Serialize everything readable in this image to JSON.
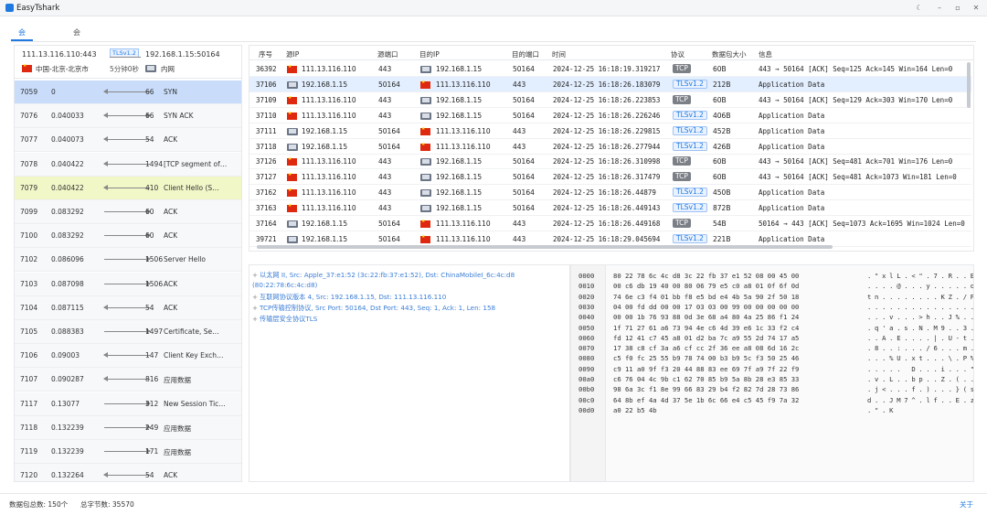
{
  "window": {
    "title": "EasyTshark"
  },
  "tabs": [
    {
      "label": "会话时序图",
      "active": true
    },
    {
      "label": "会话数据流",
      "active": false
    }
  ],
  "session_header": {
    "src": "111.13.116.110:443",
    "dst": "192.168.1.15:50164",
    "protocol": "TLSv1.2",
    "duration": "5分钟0秒",
    "src_location": "中国-北京-北京市",
    "dst_location": "内网"
  },
  "session_rows": [
    {
      "no": "7059",
      "time": "0",
      "len": "66",
      "info": "SYN",
      "dir": "left",
      "state": "selected"
    },
    {
      "no": "7076",
      "time": "0.040033",
      "len": "66",
      "info": "SYN ACK",
      "dir": "left-right",
      "state": ""
    },
    {
      "no": "7077",
      "time": "0.040073",
      "len": "54",
      "info": "ACK",
      "dir": "left",
      "state": ""
    },
    {
      "no": "7078",
      "time": "0.040422",
      "len": "1494",
      "info": "[TCP segment of…",
      "dir": "left",
      "state": ""
    },
    {
      "no": "7079",
      "time": "0.040422",
      "len": "410",
      "info": "Client Hello (S…",
      "dir": "left",
      "state": "highlight"
    },
    {
      "no": "7099",
      "time": "0.083292",
      "len": "60",
      "info": "ACK",
      "dir": "right",
      "state": ""
    },
    {
      "no": "7100",
      "time": "0.083292",
      "len": "60",
      "info": "ACK",
      "dir": "right",
      "state": ""
    },
    {
      "no": "7102",
      "time": "0.086096",
      "len": "1506",
      "info": "Server Hello",
      "dir": "right",
      "state": ""
    },
    {
      "no": "7103",
      "time": "0.087098",
      "len": "1506",
      "info": "ACK",
      "dir": "right",
      "state": ""
    },
    {
      "no": "7104",
      "time": "0.087115",
      "len": "54",
      "info": "ACK",
      "dir": "left",
      "state": ""
    },
    {
      "no": "7105",
      "time": "0.088383",
      "len": "1497",
      "info": "Certificate, Se…",
      "dir": "right",
      "state": ""
    },
    {
      "no": "7106",
      "time": "0.09003",
      "len": "147",
      "info": "Client Key Exch…",
      "dir": "left",
      "state": ""
    },
    {
      "no": "7107",
      "time": "0.090287",
      "len": "816",
      "info": "应用数据",
      "dir": "left",
      "state": ""
    },
    {
      "no": "7117",
      "time": "0.13077",
      "len": "312",
      "info": "New Session Tic…",
      "dir": "right",
      "state": ""
    },
    {
      "no": "7118",
      "time": "0.132239",
      "len": "249",
      "info": "应用数据",
      "dir": "right",
      "state": ""
    },
    {
      "no": "7119",
      "time": "0.132239",
      "len": "171",
      "info": "应用数据",
      "dir": "right",
      "state": ""
    },
    {
      "no": "7120",
      "time": "0.132264",
      "len": "54",
      "info": "ACK",
      "dir": "left",
      "state": ""
    }
  ],
  "packet_table": {
    "columns": [
      "序号",
      "源IP",
      "源端口",
      "目的IP",
      "目的端口",
      "时间",
      "协议",
      "数据包大小",
      "信息"
    ],
    "rows": [
      {
        "no": "36392",
        "src_ip": "111.13.116.110",
        "src_cn": true,
        "src_port": "443",
        "dst_ip": "192.168.1.15",
        "dst_cn": false,
        "dst_port": "50164",
        "time": "2024-12-25 16:18:19.319217",
        "proto": "TCP",
        "size": "60B",
        "info": "443 → 50164 [ACK] Seq=125 Ack=145 Win=164 Len=0"
      },
      {
        "no": "37106",
        "src_ip": "192.168.1.15",
        "src_cn": false,
        "src_port": "50164",
        "dst_ip": "111.13.116.110",
        "dst_cn": true,
        "dst_port": "443",
        "time": "2024-12-25 16:18:26.183079",
        "proto": "TLSv1.2",
        "size": "212B",
        "info": "Application Data"
      },
      {
        "no": "37109",
        "src_ip": "111.13.116.110",
        "src_cn": true,
        "src_port": "443",
        "dst_ip": "192.168.1.15",
        "dst_cn": false,
        "dst_port": "50164",
        "time": "2024-12-25 16:18:26.223853",
        "proto": "TCP",
        "size": "60B",
        "info": "443 → 50164 [ACK] Seq=129 Ack=303 Win=170 Len=0"
      },
      {
        "no": "37110",
        "src_ip": "111.13.116.110",
        "src_cn": true,
        "src_port": "443",
        "dst_ip": "192.168.1.15",
        "dst_cn": false,
        "dst_port": "50164",
        "time": "2024-12-25 16:18:26.226246",
        "proto": "TLSv1.2",
        "size": "406B",
        "info": "Application Data"
      },
      {
        "no": "37111",
        "src_ip": "192.168.1.15",
        "src_cn": false,
        "src_port": "50164",
        "dst_ip": "111.13.116.110",
        "dst_cn": true,
        "dst_port": "443",
        "time": "2024-12-25 16:18:26.229815",
        "proto": "TLSv1.2",
        "size": "452B",
        "info": "Application Data"
      },
      {
        "no": "37118",
        "src_ip": "192.168.1.15",
        "src_cn": false,
        "src_port": "50164",
        "dst_ip": "111.13.116.110",
        "dst_cn": true,
        "dst_port": "443",
        "time": "2024-12-25 16:18:26.277944",
        "proto": "TLSv1.2",
        "size": "426B",
        "info": "Application Data"
      },
      {
        "no": "37126",
        "src_ip": "111.13.116.110",
        "src_cn": true,
        "src_port": "443",
        "dst_ip": "192.168.1.15",
        "dst_cn": false,
        "dst_port": "50164",
        "time": "2024-12-25 16:18:26.310998",
        "proto": "TCP",
        "size": "60B",
        "info": "443 → 50164 [ACK] Seq=481 Ack=701 Win=176 Len=0"
      },
      {
        "no": "37127",
        "src_ip": "111.13.116.110",
        "src_cn": true,
        "src_port": "443",
        "dst_ip": "192.168.1.15",
        "dst_cn": false,
        "dst_port": "50164",
        "time": "2024-12-25 16:18:26.317479",
        "proto": "TCP",
        "size": "60B",
        "info": "443 → 50164 [ACK] Seq=481 Ack=1073 Win=181 Len=0"
      },
      {
        "no": "37162",
        "src_ip": "111.13.116.110",
        "src_cn": true,
        "src_port": "443",
        "dst_ip": "192.168.1.15",
        "dst_cn": false,
        "dst_port": "50164",
        "time": "2024-12-25 16:18:26.44879",
        "proto": "TLSv1.2",
        "size": "450B",
        "info": "Application Data"
      },
      {
        "no": "37163",
        "src_ip": "111.13.116.110",
        "src_cn": true,
        "src_port": "443",
        "dst_ip": "192.168.1.15",
        "dst_cn": false,
        "dst_port": "50164",
        "time": "2024-12-25 16:18:26.449143",
        "proto": "TLSv1.2",
        "size": "872B",
        "info": "Application Data"
      },
      {
        "no": "37164",
        "src_ip": "192.168.1.15",
        "src_cn": false,
        "src_port": "50164",
        "dst_ip": "111.13.116.110",
        "dst_cn": true,
        "dst_port": "443",
        "time": "2024-12-25 16:18:26.449168",
        "proto": "TCP",
        "size": "54B",
        "info": "50164 → 443 [ACK] Seq=1073 Ack=1695 Win=1024 Len=0"
      },
      {
        "no": "39721",
        "src_ip": "192.168.1.15",
        "src_cn": false,
        "src_port": "50164",
        "dst_ip": "111.13.116.110",
        "dst_cn": true,
        "dst_port": "443",
        "time": "2024-12-25 16:18:29.045694",
        "proto": "TLSv1.2",
        "size": "221B",
        "info": "Application Data"
      }
    ]
  },
  "details": [
    "以太网 II, Src: Apple_37:e1:52 (3c:22:fb:37:e1:52), Dst: ChinaMobileI_6c:4c:d8 (80:22:78:6c:4c:d8)",
    "互联网协议版本 4, Src: 192.168.1.15, Dst: 111.13.116.110",
    "TCP传输控制协议, Src Port: 50164, Dst Port: 443, Seq: 1, Ack: 1, Len: 158",
    "传输层安全协议TLS"
  ],
  "hex_dump": [
    {
      "off": "0000",
      "hex": "80 22 78 6c 4c d8 3c 22 fb 37 e1 52 08 00 45 00",
      "ascii": ". \" x l L . < \" . 7 . R . . E ."
    },
    {
      "off": "0010",
      "hex": "00 c6 db 19 40 00 80 06 79 e5 c0 a8 01 0f 6f 0d",
      "ascii": ". . . . @ . . . y . . . . . o ."
    },
    {
      "off": "0020",
      "hex": "74 6e c3 f4 01 bb f8 e5 bd e4 4b 5a 90 2f 50 18",
      "ascii": "t n . . . . . . . . K Z . / P ."
    },
    {
      "off": "0030",
      "hex": "04 00 fd dd 00 00 17 03 03 00 99 00 00 00 00 00",
      "ascii": ". . . . . . . . . . . . . . . ."
    },
    {
      "off": "0040",
      "hex": "00 00 1b 76 93 88 0d 3e 68 a4 80 4a 25 86 f1 24",
      "ascii": ". . . v . . . > h . . J % . . $"
    },
    {
      "off": "0050",
      "hex": "1f 71 27 61 a6 73 94 4e c6 4d 39 e6 1c 33 f2 c4",
      "ascii": ". q ' a . s . N . M 9 . . 3 . ."
    },
    {
      "off": "0060",
      "hex": "fd 12 41 c7 45 a8 01 d2 ba 7c a9 55 2d 74 17 a5",
      "ascii": ". . A . E . . . . | . U - t . ."
    },
    {
      "off": "0070",
      "hex": "17 38 c8 cf 3a a6 cf cc 2f 36 ee a8 08 6d 16 2c",
      "ascii": ". 8 . . : . . . / 6 . . . m . ,"
    },
    {
      "off": "0080",
      "hex": "c5 f0 fc 25 55 b9 78 74 00 b3 b9 5c f3 50 25 46",
      "ascii": ". . . % U . x t . . . \\ . P % F"
    },
    {
      "off": "0090",
      "hex": "c9 11 a0 9f f3 20 44 88 83 ee 69 7f a9 7f 22 f9",
      "ascii": ". . . . .   D . . . i . . . \" ."
    },
    {
      "off": "00a0",
      "hex": "c6 76 04 4c 9b c1 62 70 85 b9 5a 8b 28 e3 85 33",
      "ascii": ". v . L . . b p . . Z . ( . . 3"
    },
    {
      "off": "00b0",
      "hex": "98 6a 3c f1 8e 99 66 83 29 b4 f2 82 7d 28 73 86",
      "ascii": ". j < . . . f . ) . . . } ( s ."
    },
    {
      "off": "00c0",
      "hex": "64 8b ef 4a 4d 37 5e 1b 6c 66 e4 c5 45 f9 7a 32",
      "ascii": "d . . J M 7 ^ . l f . . E . z 2"
    },
    {
      "off": "00d0",
      "hex": "a0 22 b5 4b",
      "ascii": ". \" . K"
    }
  ],
  "status": {
    "packet_count": "数据包总数: 150个",
    "total_bytes": "总字节数: 35570",
    "about": "关于"
  },
  "colors": {
    "accent": "#1f7ae0",
    "selected_row": "#c9ddfb",
    "highlight_row": "#f2f7c8"
  }
}
